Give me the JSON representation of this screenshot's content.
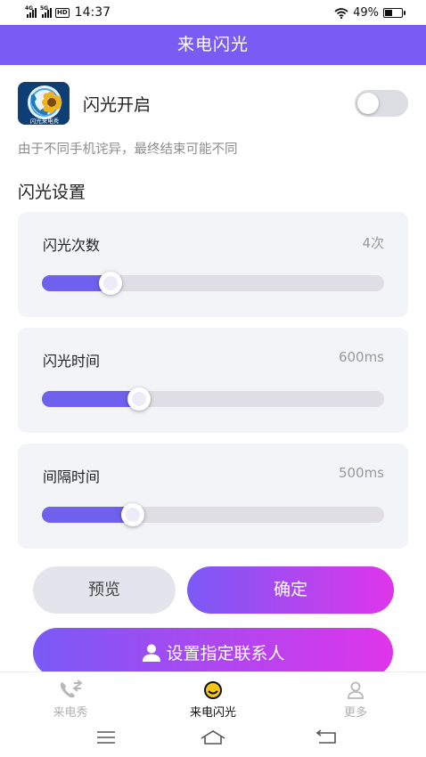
{
  "status_bar": {
    "signal_1": "4G",
    "signal_2": "5G",
    "hd_badge": "HD",
    "time": "14:37",
    "battery_percent": "49%",
    "battery_level": 0.49,
    "icons": [
      "signal-icon",
      "signal-icon",
      "hd-icon",
      "wifi-icon",
      "battery-icon"
    ]
  },
  "header": {
    "title": "来电闪光"
  },
  "flash_toggle": {
    "label": "闪光开启",
    "enabled": false,
    "app_icon_text": "闪光来电秀",
    "notice": "由于不同手机诧异，最终结束可能不同"
  },
  "settings": {
    "title": "闪光设置",
    "items": [
      {
        "label": "闪光次数",
        "value": "4次",
        "fraction": 0.2
      },
      {
        "label": "闪光时间",
        "value": "600ms",
        "fraction": 0.285
      },
      {
        "label": "间隔时间",
        "value": "500ms",
        "fraction": 0.265
      }
    ]
  },
  "actions": {
    "preview": "预览",
    "confirm": "确定",
    "set_contact": "设置指定联系人"
  },
  "tabs": [
    {
      "label": "来电秀",
      "icon": "phone-icon",
      "active": false
    },
    {
      "label": "来电闪光",
      "icon": "smiley-icon",
      "active": true
    },
    {
      "label": "更多",
      "icon": "person-icon",
      "active": false
    }
  ],
  "colors": {
    "accent": "#7a5cf5",
    "gradient_start": "#7a5af6",
    "gradient_end": "#df35ea",
    "slider_fill": "#6f60ee",
    "card_bg": "#f3f4f8"
  }
}
